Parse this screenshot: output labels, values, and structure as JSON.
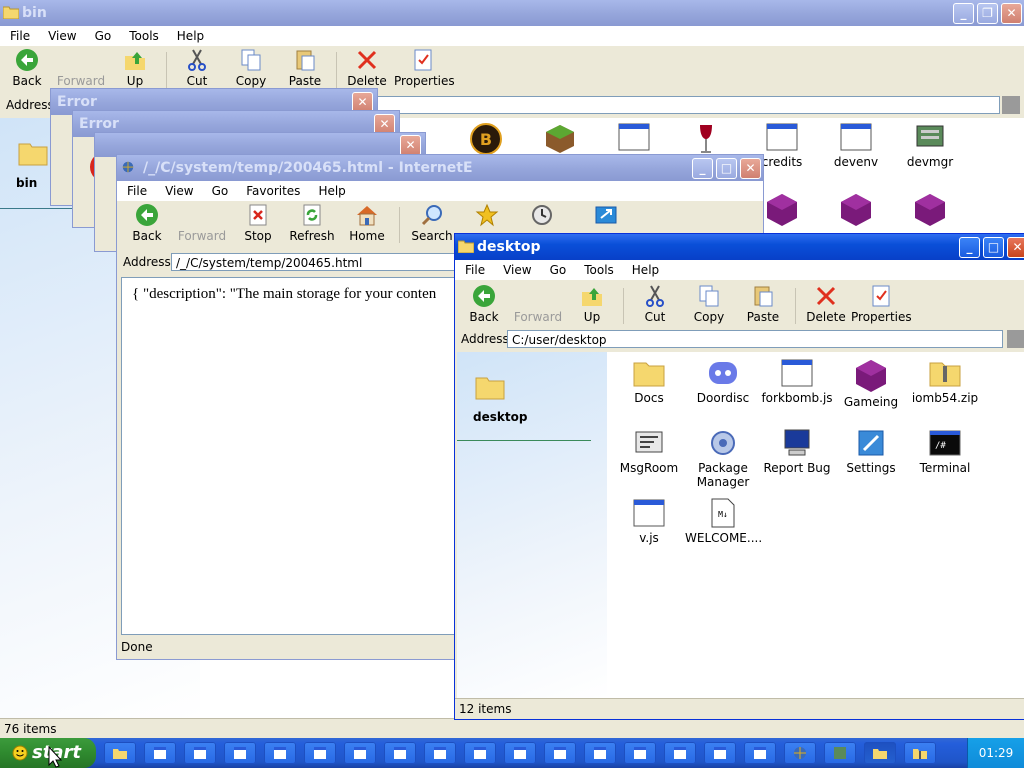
{
  "bin": {
    "title": "bin",
    "menu": [
      "File",
      "View",
      "Go",
      "Tools",
      "Help"
    ],
    "toolbar": {
      "back": "Back",
      "forward": "Forward",
      "up": "Up",
      "cut": "Cut",
      "copy": "Copy",
      "paste": "Paste",
      "delete": "Delete",
      "properties": "Properties"
    },
    "address_label": "Address",
    "sidebar_title": "bin",
    "icons": [
      {
        "label": "",
        "icon": "b-logo-icon"
      },
      {
        "label": "",
        "icon": "grass-block-icon"
      },
      {
        "label": "",
        "icon": "window-icon"
      },
      {
        "label": "",
        "icon": "wine-glass-icon"
      },
      {
        "label": "credits",
        "icon": "window-icon"
      },
      {
        "label": "devenv",
        "icon": "window-icon"
      },
      {
        "label": "devmgr",
        "icon": "device-manager-icon"
      },
      {
        "label": "",
        "icon": "purple-cube-icon"
      },
      {
        "label": "",
        "icon": "purple-cube-icon"
      },
      {
        "label": "",
        "icon": "purple-cube-icon"
      }
    ],
    "status": "76 items"
  },
  "error1": {
    "title": "Error"
  },
  "error2": {
    "title": "Error"
  },
  "ie": {
    "title": "/_/C/system/temp/200465.html - InternetE",
    "menu": [
      "File",
      "View",
      "Go",
      "Favorites",
      "Help"
    ],
    "toolbar": {
      "back": "Back",
      "forward": "Forward",
      "stop": "Stop",
      "refresh": "Refresh",
      "home": "Home",
      "search": "Search"
    },
    "address_label": "Address:",
    "address_value": "/_/C/system/temp/200465.html",
    "content": "{ \"description\": \"The main storage for your conten",
    "status": "Done"
  },
  "desktop": {
    "title": "desktop",
    "menu": [
      "File",
      "View",
      "Go",
      "Tools",
      "Help"
    ],
    "toolbar": {
      "back": "Back",
      "forward": "Forward",
      "up": "Up",
      "cut": "Cut",
      "copy": "Copy",
      "paste": "Paste",
      "delete": "Delete",
      "properties": "Properties"
    },
    "address_label": "Address",
    "address_value": "C:/user/desktop",
    "sidebar_title": "desktop",
    "icons": [
      {
        "label": "Docs",
        "icon": "folder-icon"
      },
      {
        "label": "Doordisc",
        "icon": "discord-icon"
      },
      {
        "label": "forkbomb.js",
        "icon": "window-icon"
      },
      {
        "label": "Gameing",
        "icon": "purple-cube-icon"
      },
      {
        "label": "iomb54.zip",
        "icon": "zip-folder-icon"
      },
      {
        "label": "MsgRoom",
        "icon": "msgroom-icon"
      },
      {
        "label": "Package Manager",
        "icon": "package-icon"
      },
      {
        "label": "Report Bug",
        "icon": "computer-icon"
      },
      {
        "label": "Settings",
        "icon": "settings-icon"
      },
      {
        "label": "Terminal",
        "icon": "terminal-icon"
      },
      {
        "label": "v.js",
        "icon": "window-icon"
      },
      {
        "label": "WELCOME....",
        "icon": "markdown-icon"
      }
    ],
    "status": "12 items"
  },
  "taskbar": {
    "start_label": "start",
    "clock": "01:29"
  }
}
